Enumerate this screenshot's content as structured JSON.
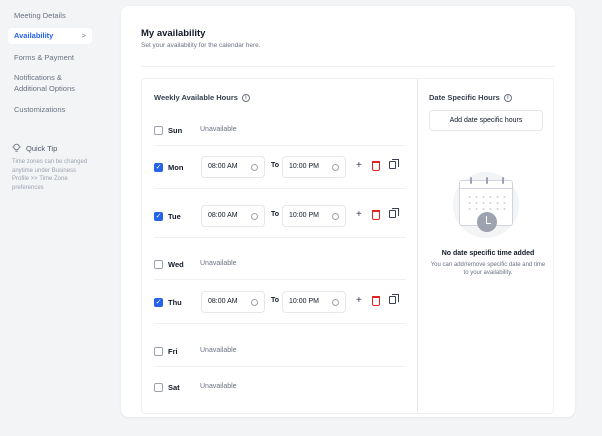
{
  "sidebar": {
    "items": [
      {
        "label": "Meeting Details"
      },
      {
        "label": "Availability",
        "chevron": ">"
      },
      {
        "label": "Forms & Payment"
      },
      {
        "label": "Notifications & Additional Options"
      },
      {
        "label": "Customizations"
      }
    ],
    "quick_tip": {
      "title": "Quick Tip",
      "body": "Time zones can be changed anytime under Business Profile >> Time Zone preferences"
    }
  },
  "header": {
    "title": "My availability",
    "subtitle": "Set your availability for the calendar here."
  },
  "weekly": {
    "heading": "Weekly Available Hours",
    "to_label": "To",
    "unavailable_label": "Unavailable",
    "days": [
      {
        "name": "Sun",
        "checked": false
      },
      {
        "name": "Mon",
        "checked": true,
        "start": "08:00 AM",
        "end": "10:00 PM"
      },
      {
        "name": "Tue",
        "checked": true,
        "start": "08:00 AM",
        "end": "10:00 PM"
      },
      {
        "name": "Wed",
        "checked": false
      },
      {
        "name": "Thu",
        "checked": true,
        "start": "08:00 AM",
        "end": "10:00 PM"
      },
      {
        "name": "Fri",
        "checked": false
      },
      {
        "name": "Sat",
        "checked": false
      }
    ]
  },
  "date_specific": {
    "heading": "Date Specific Hours",
    "button_label": "Add date specific hours",
    "empty_title": "No date specific time added",
    "empty_body": "You can add/remove specific date and time to your availability."
  },
  "colors": {
    "accent": "#2563eb",
    "danger": "#dc2626"
  }
}
